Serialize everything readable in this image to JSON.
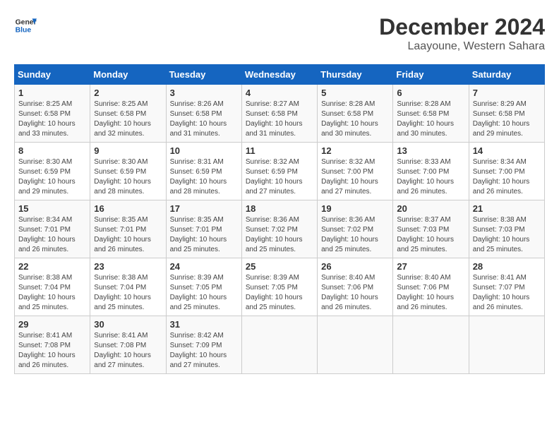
{
  "header": {
    "logo_line1": "General",
    "logo_line2": "Blue",
    "title": "December 2024",
    "subtitle": "Laayoune, Western Sahara"
  },
  "days_of_week": [
    "Sunday",
    "Monday",
    "Tuesday",
    "Wednesday",
    "Thursday",
    "Friday",
    "Saturday"
  ],
  "weeks": [
    [
      {
        "day": "1",
        "info": "Sunrise: 8:25 AM\nSunset: 6:58 PM\nDaylight: 10 hours\nand 33 minutes."
      },
      {
        "day": "2",
        "info": "Sunrise: 8:25 AM\nSunset: 6:58 PM\nDaylight: 10 hours\nand 32 minutes."
      },
      {
        "day": "3",
        "info": "Sunrise: 8:26 AM\nSunset: 6:58 PM\nDaylight: 10 hours\nand 31 minutes."
      },
      {
        "day": "4",
        "info": "Sunrise: 8:27 AM\nSunset: 6:58 PM\nDaylight: 10 hours\nand 31 minutes."
      },
      {
        "day": "5",
        "info": "Sunrise: 8:28 AM\nSunset: 6:58 PM\nDaylight: 10 hours\nand 30 minutes."
      },
      {
        "day": "6",
        "info": "Sunrise: 8:28 AM\nSunset: 6:58 PM\nDaylight: 10 hours\nand 30 minutes."
      },
      {
        "day": "7",
        "info": "Sunrise: 8:29 AM\nSunset: 6:58 PM\nDaylight: 10 hours\nand 29 minutes."
      }
    ],
    [
      {
        "day": "8",
        "info": "Sunrise: 8:30 AM\nSunset: 6:59 PM\nDaylight: 10 hours\nand 29 minutes."
      },
      {
        "day": "9",
        "info": "Sunrise: 8:30 AM\nSunset: 6:59 PM\nDaylight: 10 hours\nand 28 minutes."
      },
      {
        "day": "10",
        "info": "Sunrise: 8:31 AM\nSunset: 6:59 PM\nDaylight: 10 hours\nand 28 minutes."
      },
      {
        "day": "11",
        "info": "Sunrise: 8:32 AM\nSunset: 6:59 PM\nDaylight: 10 hours\nand 27 minutes."
      },
      {
        "day": "12",
        "info": "Sunrise: 8:32 AM\nSunset: 7:00 PM\nDaylight: 10 hours\nand 27 minutes."
      },
      {
        "day": "13",
        "info": "Sunrise: 8:33 AM\nSunset: 7:00 PM\nDaylight: 10 hours\nand 26 minutes."
      },
      {
        "day": "14",
        "info": "Sunrise: 8:34 AM\nSunset: 7:00 PM\nDaylight: 10 hours\nand 26 minutes."
      }
    ],
    [
      {
        "day": "15",
        "info": "Sunrise: 8:34 AM\nSunset: 7:01 PM\nDaylight: 10 hours\nand 26 minutes."
      },
      {
        "day": "16",
        "info": "Sunrise: 8:35 AM\nSunset: 7:01 PM\nDaylight: 10 hours\nand 26 minutes."
      },
      {
        "day": "17",
        "info": "Sunrise: 8:35 AM\nSunset: 7:01 PM\nDaylight: 10 hours\nand 25 minutes."
      },
      {
        "day": "18",
        "info": "Sunrise: 8:36 AM\nSunset: 7:02 PM\nDaylight: 10 hours\nand 25 minutes."
      },
      {
        "day": "19",
        "info": "Sunrise: 8:36 AM\nSunset: 7:02 PM\nDaylight: 10 hours\nand 25 minutes."
      },
      {
        "day": "20",
        "info": "Sunrise: 8:37 AM\nSunset: 7:03 PM\nDaylight: 10 hours\nand 25 minutes."
      },
      {
        "day": "21",
        "info": "Sunrise: 8:38 AM\nSunset: 7:03 PM\nDaylight: 10 hours\nand 25 minutes."
      }
    ],
    [
      {
        "day": "22",
        "info": "Sunrise: 8:38 AM\nSunset: 7:04 PM\nDaylight: 10 hours\nand 25 minutes."
      },
      {
        "day": "23",
        "info": "Sunrise: 8:38 AM\nSunset: 7:04 PM\nDaylight: 10 hours\nand 25 minutes."
      },
      {
        "day": "24",
        "info": "Sunrise: 8:39 AM\nSunset: 7:05 PM\nDaylight: 10 hours\nand 25 minutes."
      },
      {
        "day": "25",
        "info": "Sunrise: 8:39 AM\nSunset: 7:05 PM\nDaylight: 10 hours\nand 25 minutes."
      },
      {
        "day": "26",
        "info": "Sunrise: 8:40 AM\nSunset: 7:06 PM\nDaylight: 10 hours\nand 26 minutes."
      },
      {
        "day": "27",
        "info": "Sunrise: 8:40 AM\nSunset: 7:06 PM\nDaylight: 10 hours\nand 26 minutes."
      },
      {
        "day": "28",
        "info": "Sunrise: 8:41 AM\nSunset: 7:07 PM\nDaylight: 10 hours\nand 26 minutes."
      }
    ],
    [
      {
        "day": "29",
        "info": "Sunrise: 8:41 AM\nSunset: 7:08 PM\nDaylight: 10 hours\nand 26 minutes."
      },
      {
        "day": "30",
        "info": "Sunrise: 8:41 AM\nSunset: 7:08 PM\nDaylight: 10 hours\nand 27 minutes."
      },
      {
        "day": "31",
        "info": "Sunrise: 8:42 AM\nSunset: 7:09 PM\nDaylight: 10 hours\nand 27 minutes."
      },
      null,
      null,
      null,
      null
    ]
  ]
}
